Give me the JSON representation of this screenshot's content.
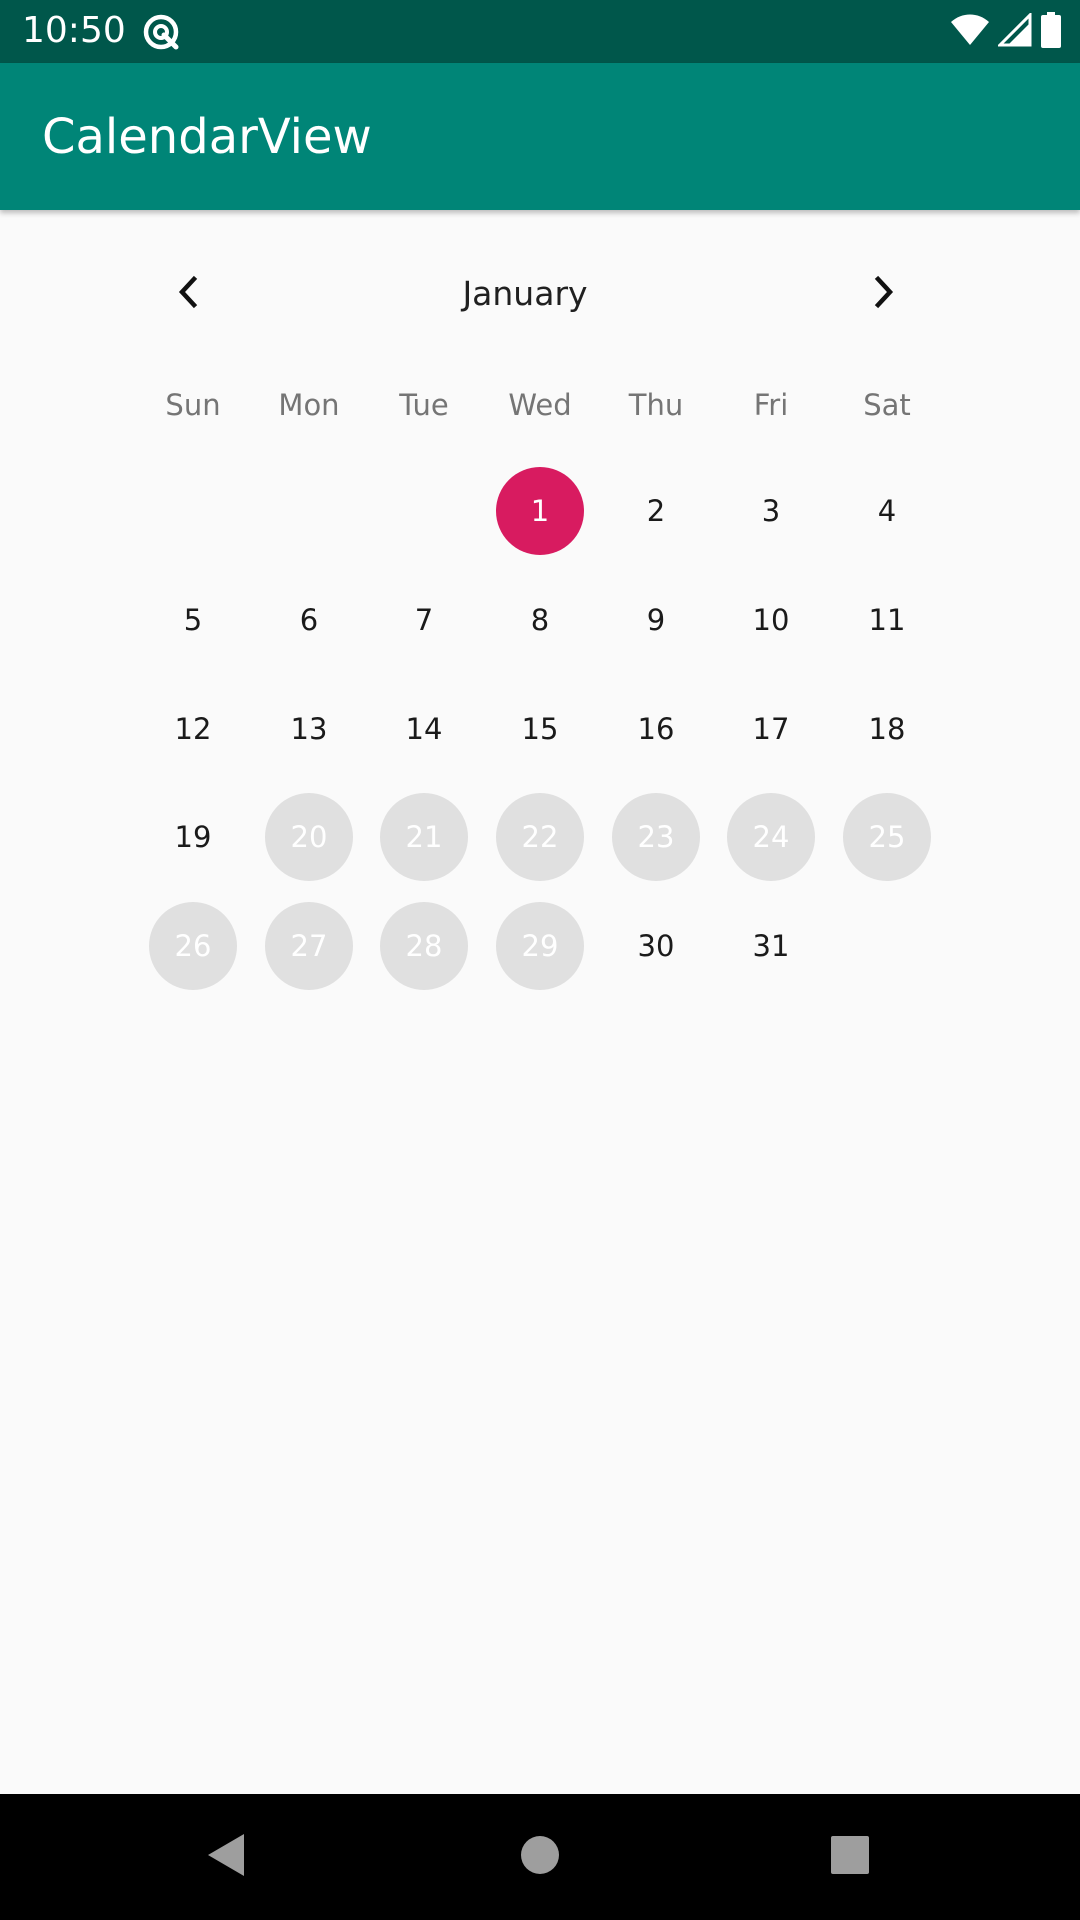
{
  "status_bar": {
    "time": "10:50",
    "app_icon": "at-sign-notification-icon",
    "icons": [
      "wifi-icon",
      "cell-signal-icon",
      "battery-icon"
    ],
    "color": "#00574b"
  },
  "app_bar": {
    "title": "CalendarView",
    "color": "#008577"
  },
  "calendar": {
    "month": "January",
    "prev_icon": "chevron-left-icon",
    "next_icon": "chevron-right-icon",
    "weekdays": [
      "Sun",
      "Mon",
      "Tue",
      "Wed",
      "Thu",
      "Fri",
      "Sat"
    ],
    "weeks": [
      [
        "",
        "",
        "",
        "1",
        "2",
        "3",
        "4"
      ],
      [
        "5",
        "6",
        "7",
        "8",
        "9",
        "10",
        "11"
      ],
      [
        "12",
        "13",
        "14",
        "15",
        "16",
        "17",
        "18"
      ],
      [
        "19",
        "20",
        "21",
        "22",
        "23",
        "24",
        "25"
      ],
      [
        "26",
        "27",
        "28",
        "29",
        "30",
        "31",
        ""
      ]
    ],
    "selected_day": "1",
    "disabled_days": [
      "20",
      "21",
      "22",
      "23",
      "24",
      "25",
      "26",
      "27",
      "28",
      "29"
    ],
    "selected_color": "#d81b60",
    "disabled_color": "#e0e0e0"
  },
  "nav_bar": {
    "buttons": [
      "back-icon",
      "home-icon",
      "recents-icon"
    ]
  }
}
